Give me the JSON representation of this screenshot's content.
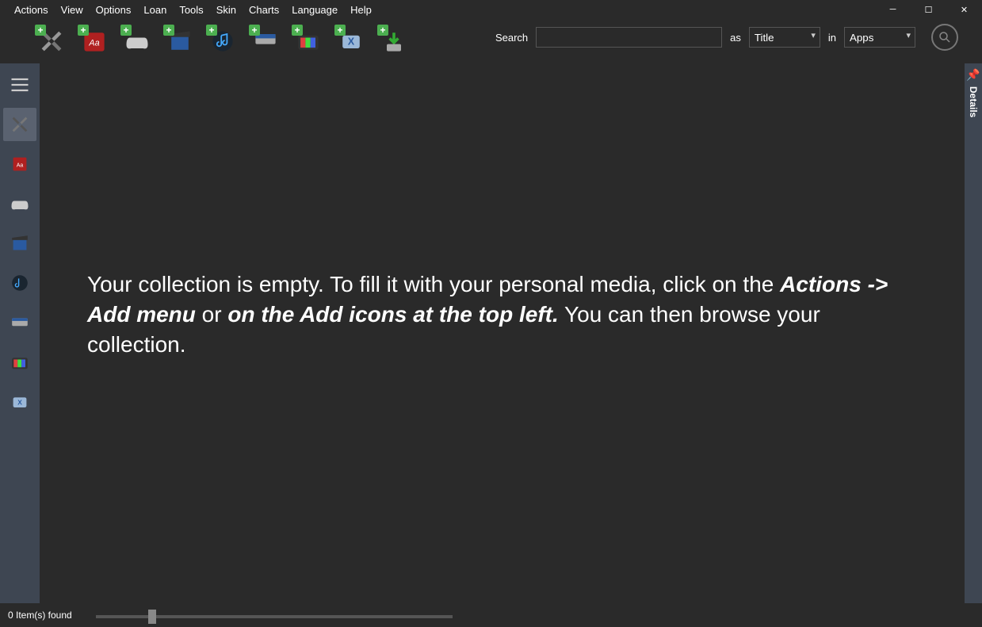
{
  "menu": [
    "Actions",
    "View",
    "Options",
    "Loan",
    "Tools",
    "Skin",
    "Charts",
    "Language",
    "Help"
  ],
  "toolbar_icons": [
    "tools",
    "book",
    "gamepad",
    "movie",
    "music",
    "console",
    "tv",
    "xbmc",
    "download"
  ],
  "search": {
    "label": "Search",
    "value": "",
    "as_label": "as",
    "as_value": "Title",
    "in_label": "in",
    "in_value": "Apps"
  },
  "sidebar_icons": [
    "menu",
    "tools",
    "book",
    "gamepad",
    "movie",
    "music",
    "console",
    "tv",
    "xbmc"
  ],
  "empty": {
    "part1": "Your collection is empty. To fill it with your personal media, click on the ",
    "bold1": "Actions -> Add menu",
    "part2": " or ",
    "bold2": "on the Add icons at the top left.",
    "part3": " You can then browse your collection."
  },
  "details_panel": "Details",
  "status": "0 Item(s) found"
}
